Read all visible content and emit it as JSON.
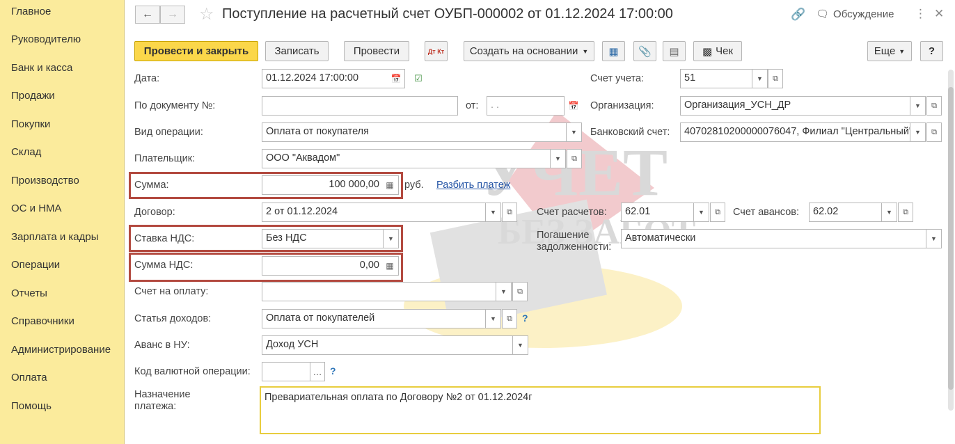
{
  "sidebar": {
    "items": [
      "Главное",
      "Руководителю",
      "Банк и касса",
      "Продажи",
      "Покупки",
      "Склад",
      "Производство",
      "ОС и НМА",
      "Зарплата и кадры",
      "Операции",
      "Отчеты",
      "Справочники",
      "Администрирование",
      "Оплата",
      "Помощь"
    ]
  },
  "header": {
    "title": "Поступление на расчетный счет ОУБП-000002 от 01.12.2024 17:00:00",
    "discussion": "Обсуждение"
  },
  "toolbar": {
    "post_close": "Провести и закрыть",
    "save": "Записать",
    "post": "Провести",
    "dt_kt": "Дт Кт",
    "create_based": "Создать на основании",
    "check": "Чек",
    "more": "Еще",
    "help": "?"
  },
  "form": {
    "date_label": "Дата:",
    "date_value": "01.12.2024 17:00:00",
    "docnum_label": "По документу №:",
    "docnum_value": "",
    "from_label": "от:",
    "from_value": " .  .",
    "optype_label": "Вид операции:",
    "optype_value": "Оплата от покупателя",
    "payer_label": "Плательщик:",
    "payer_value": "ООО \"Аквадом\"",
    "sum_label": "Сумма:",
    "sum_value": "100 000,00",
    "sum_currency": "руб.",
    "split_link": "Разбить платеж",
    "contract_label": "Договор:",
    "contract_value": "2 от 01.12.2024",
    "vat_rate_label": "Ставка НДС:",
    "vat_rate_value": "Без НДС",
    "vat_sum_label": "Сумма НДС:",
    "vat_sum_value": "0,00",
    "invoice_label": "Счет на оплату:",
    "invoice_value": "",
    "income_label": "Статья доходов:",
    "income_value": "Оплата от покупателей",
    "advance_label": "Аванс в НУ:",
    "advance_value": "Доход УСН",
    "currency_op_label": "Код валютной операции:",
    "currency_op_value": "",
    "purpose_label_1": "Назначение",
    "purpose_label_2": "платежа:",
    "purpose_value": "Превариательная оплата по Договору №2 от 01.12.2024г",
    "account_label": "Счет учета:",
    "account_value": "51",
    "org_label": "Организация:",
    "org_value": "Организация_УСН_ДР",
    "bank_label": "Банковский счет:",
    "bank_value": "40702810200000076047, Филиал \"Центральный\"",
    "settle_label": "Счет расчетов:",
    "settle_value": "62.01",
    "adv_acc_label": "Счет авансов:",
    "adv_acc_value": "62.02",
    "repay_label_1": "Погашение",
    "repay_label_2": "задолженности:",
    "repay_value": "Автоматически",
    "help_mark": "?"
  },
  "watermark": {
    "line1": "УЧЕТ",
    "line2": "БЕЗ ЗАБОТ"
  },
  "colors": {
    "sidebar": "#fbeb9c",
    "primary_button": "#fbd74a",
    "highlight": "#b34a40",
    "link": "#2353a5"
  }
}
